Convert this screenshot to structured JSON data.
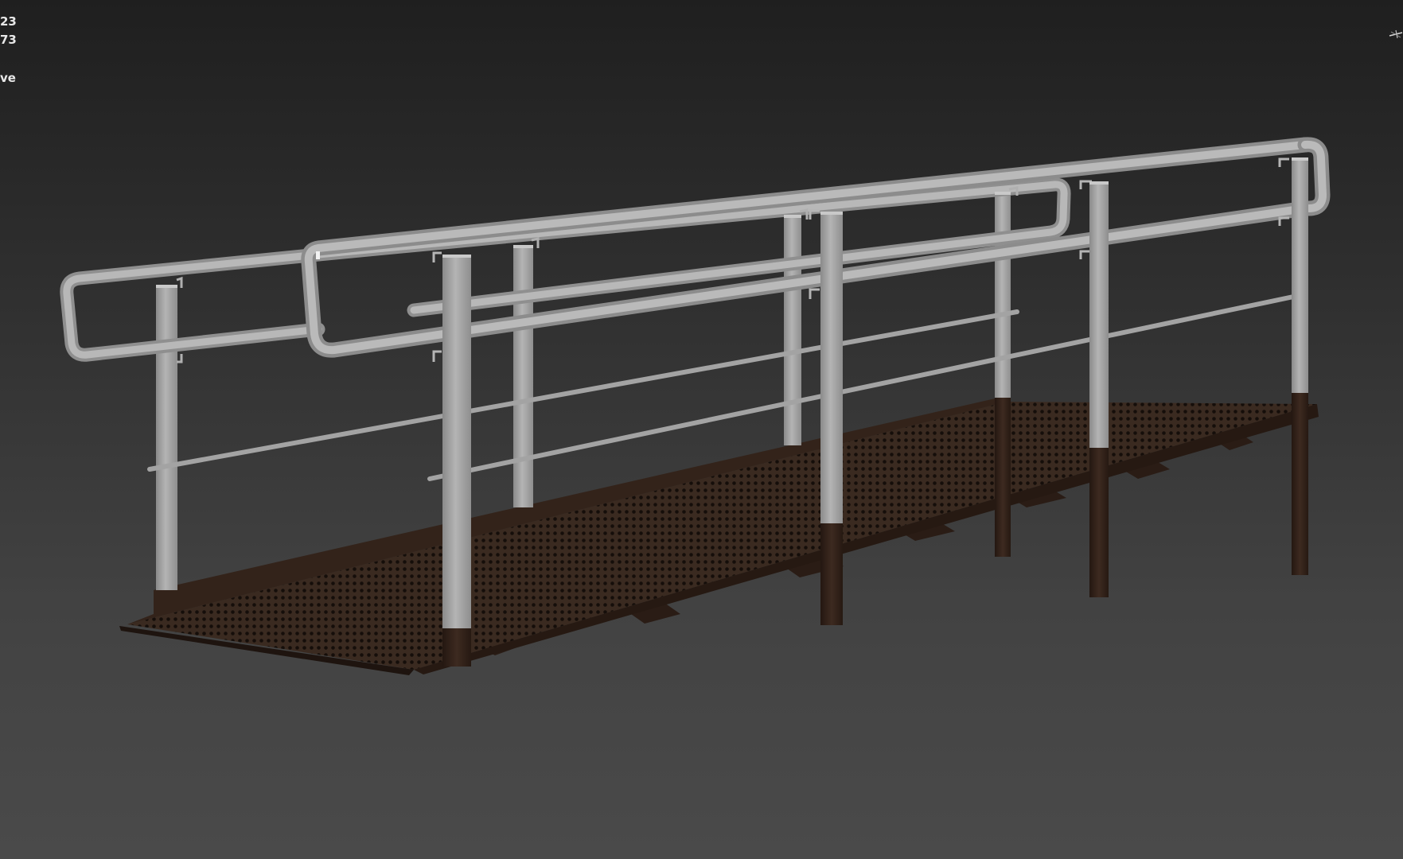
{
  "viewport": {
    "stats_lines": [
      "23",
      "73",
      "ve"
    ],
    "nav_gizmo_icon": "view-cube-axis-icon"
  },
  "colors": {
    "background_top": "#1f1f1f",
    "background_bottom": "#4a4a4a",
    "railing_metal": "#a7a7a7",
    "deck_steel": "#2c1f18",
    "overlay_text": "#e8e8e8"
  },
  "scene": {
    "object": "ramp-walkway-with-railings",
    "icon": "ramp-model-icon"
  }
}
